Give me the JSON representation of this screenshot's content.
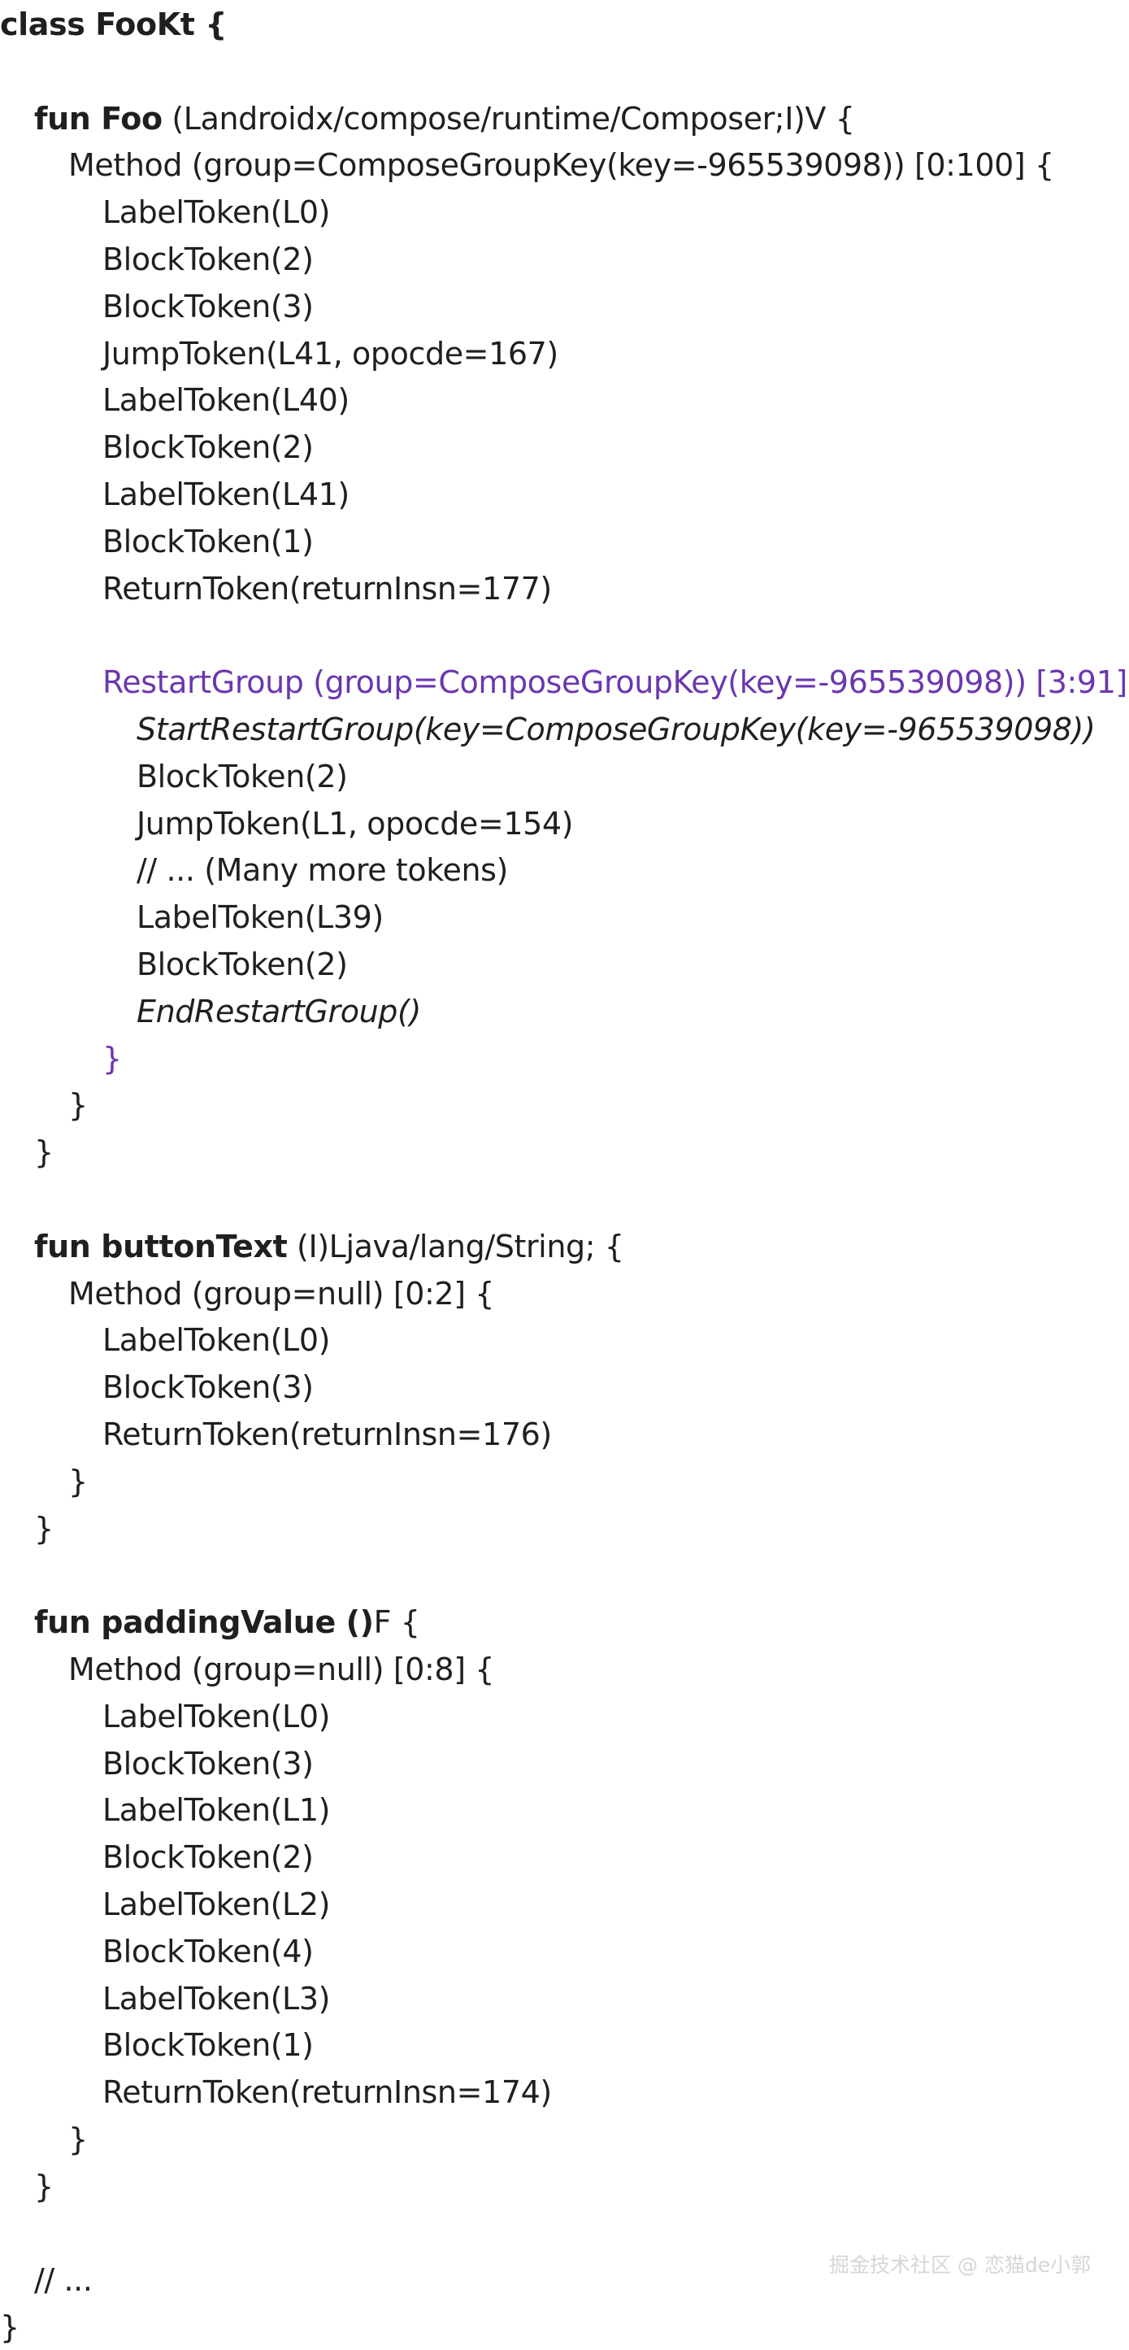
{
  "lines": [
    {
      "indent": 0,
      "kw": "class FooKt {",
      "text": "",
      "style": "bold"
    },
    {
      "indent": 0,
      "kw": "",
      "text": "",
      "style": "plain"
    },
    {
      "indent": 1,
      "kw": "fun Foo",
      "text": " (Landroidx/compose/runtime/Composer;I)V {",
      "style": "plain"
    },
    {
      "indent": 2,
      "kw": "",
      "text": "Method (group=ComposeGroupKey(key=-965539098)) [0:100] {",
      "style": "plain"
    },
    {
      "indent": 3,
      "kw": "",
      "text": "LabelToken(L0)",
      "style": "plain"
    },
    {
      "indent": 3,
      "kw": "",
      "text": "BlockToken(2)",
      "style": "plain"
    },
    {
      "indent": 3,
      "kw": "",
      "text": "BlockToken(3)",
      "style": "plain"
    },
    {
      "indent": 3,
      "kw": "",
      "text": "JumpToken(L41, opocde=167)",
      "style": "plain"
    },
    {
      "indent": 3,
      "kw": "",
      "text": "LabelToken(L40)",
      "style": "plain"
    },
    {
      "indent": 3,
      "kw": "",
      "text": "BlockToken(2)",
      "style": "plain"
    },
    {
      "indent": 3,
      "kw": "",
      "text": "LabelToken(L41)",
      "style": "plain"
    },
    {
      "indent": 3,
      "kw": "",
      "text": "BlockToken(1)",
      "style": "plain"
    },
    {
      "indent": 3,
      "kw": "",
      "text": "ReturnToken(returnInsn=177)",
      "style": "plain"
    },
    {
      "indent": 0,
      "kw": "",
      "text": "",
      "style": "plain"
    },
    {
      "indent": 3,
      "kw": "",
      "text": "RestartGroup (group=ComposeGroupKey(key=-965539098)) [3:91] {",
      "style": "purple"
    },
    {
      "indent": 4,
      "kw": "",
      "text": "StartRestartGroup(key=ComposeGroupKey(key=-965539098))",
      "style": "italic"
    },
    {
      "indent": 4,
      "kw": "",
      "text": "BlockToken(2)",
      "style": "plain"
    },
    {
      "indent": 4,
      "kw": "",
      "text": "JumpToken(L1, opocde=154)",
      "style": "plain"
    },
    {
      "indent": 4,
      "kw": "",
      "text": "// ... (Many more tokens)",
      "style": "plain"
    },
    {
      "indent": 4,
      "kw": "",
      "text": "LabelToken(L39)",
      "style": "plain"
    },
    {
      "indent": 4,
      "kw": "",
      "text": "BlockToken(2)",
      "style": "plain"
    },
    {
      "indent": 4,
      "kw": "",
      "text": "EndRestartGroup()",
      "style": "italic"
    },
    {
      "indent": 3,
      "kw": "",
      "text": "}",
      "style": "purple"
    },
    {
      "indent": 2,
      "kw": "",
      "text": "}",
      "style": "plain"
    },
    {
      "indent": 1,
      "kw": "",
      "text": "}",
      "style": "plain"
    },
    {
      "indent": 0,
      "kw": "",
      "text": "",
      "style": "plain"
    },
    {
      "indent": 1,
      "kw": "fun buttonText",
      "text": " (I)Ljava/lang/String; {",
      "style": "plain"
    },
    {
      "indent": 2,
      "kw": "",
      "text": "Method (group=null) [0:2] {",
      "style": "plain"
    },
    {
      "indent": 3,
      "kw": "",
      "text": "LabelToken(L0)",
      "style": "plain"
    },
    {
      "indent": 3,
      "kw": "",
      "text": "BlockToken(3)",
      "style": "plain"
    },
    {
      "indent": 3,
      "kw": "",
      "text": "ReturnToken(returnInsn=176)",
      "style": "plain"
    },
    {
      "indent": 2,
      "kw": "",
      "text": "}",
      "style": "plain"
    },
    {
      "indent": 1,
      "kw": "",
      "text": "}",
      "style": "plain"
    },
    {
      "indent": 0,
      "kw": "",
      "text": "",
      "style": "plain"
    },
    {
      "indent": 1,
      "kw": "fun paddingValue ()",
      "text": "F {",
      "style": "plain"
    },
    {
      "indent": 2,
      "kw": "",
      "text": "Method (group=null) [0:8] {",
      "style": "plain"
    },
    {
      "indent": 3,
      "kw": "",
      "text": "LabelToken(L0)",
      "style": "plain"
    },
    {
      "indent": 3,
      "kw": "",
      "text": "BlockToken(3)",
      "style": "plain"
    },
    {
      "indent": 3,
      "kw": "",
      "text": "LabelToken(L1)",
      "style": "plain"
    },
    {
      "indent": 3,
      "kw": "",
      "text": "BlockToken(2)",
      "style": "plain"
    },
    {
      "indent": 3,
      "kw": "",
      "text": "LabelToken(L2)",
      "style": "plain"
    },
    {
      "indent": 3,
      "kw": "",
      "text": "BlockToken(4)",
      "style": "plain"
    },
    {
      "indent": 3,
      "kw": "",
      "text": "LabelToken(L3)",
      "style": "plain"
    },
    {
      "indent": 3,
      "kw": "",
      "text": "BlockToken(1)",
      "style": "plain"
    },
    {
      "indent": 3,
      "kw": "",
      "text": "ReturnToken(returnInsn=174)",
      "style": "plain"
    },
    {
      "indent": 2,
      "kw": "",
      "text": "}",
      "style": "plain"
    },
    {
      "indent": 1,
      "kw": "",
      "text": "}",
      "style": "plain"
    },
    {
      "indent": 0,
      "kw": "",
      "text": "",
      "style": "plain"
    },
    {
      "indent": 1,
      "kw": "",
      "text": "// ...",
      "style": "plain"
    },
    {
      "indent": 0,
      "kw": "",
      "text": "}",
      "style": "plain"
    }
  ],
  "watermark": "掘金技术社区 @ 恋猫de小郭",
  "colors": {
    "text": "#1f1f1f",
    "group_highlight": "#6a37b0",
    "watermark": "#d6d6d6",
    "background": "#ffffff"
  }
}
